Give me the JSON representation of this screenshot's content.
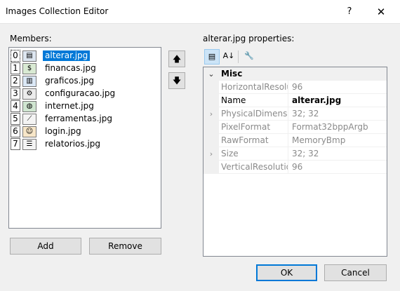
{
  "window": {
    "title": "Images Collection Editor",
    "help": "?",
    "close": "✕"
  },
  "members": {
    "label": "Members:",
    "items": [
      {
        "index": "0",
        "name": "alterar.jpg",
        "icon": "form-icon"
      },
      {
        "index": "1",
        "name": "financas.jpg",
        "icon": "money-icon"
      },
      {
        "index": "2",
        "name": "graficos.jpg",
        "icon": "chart-icon"
      },
      {
        "index": "3",
        "name": "configuracao.jpg",
        "icon": "gears-icon"
      },
      {
        "index": "4",
        "name": "internet.jpg",
        "icon": "globe-icon"
      },
      {
        "index": "5",
        "name": "ferramentas.jpg",
        "icon": "tools-icon"
      },
      {
        "index": "6",
        "name": "login.jpg",
        "icon": "user-icon"
      },
      {
        "index": "7",
        "name": "relatorios.jpg",
        "icon": "report-icon"
      }
    ],
    "selected_index": 0
  },
  "move_up": "🡅",
  "move_down": "🡇",
  "add_label": "Add",
  "remove_label": "Remove",
  "properties": {
    "label": "alterar.jpg properties:",
    "toolbar": {
      "categorized": "▤",
      "alphabetical": "A↓",
      "property_pages": "🔧"
    },
    "category": "Misc",
    "rows": [
      {
        "name": "HorizontalResolution",
        "value": "96",
        "expandable": false
      },
      {
        "name": "Name",
        "value": "alterar.jpg",
        "expandable": false,
        "active": true
      },
      {
        "name": "PhysicalDimension",
        "value": "32; 32",
        "expandable": true
      },
      {
        "name": "PixelFormat",
        "value": "Format32bppArgb",
        "expandable": false
      },
      {
        "name": "RawFormat",
        "value": "MemoryBmp",
        "expandable": false
      },
      {
        "name": "Size",
        "value": "32; 32",
        "expandable": true
      },
      {
        "name": "VerticalResolution",
        "value": "96",
        "expandable": false
      }
    ]
  },
  "ok_label": "OK",
  "cancel_label": "Cancel"
}
